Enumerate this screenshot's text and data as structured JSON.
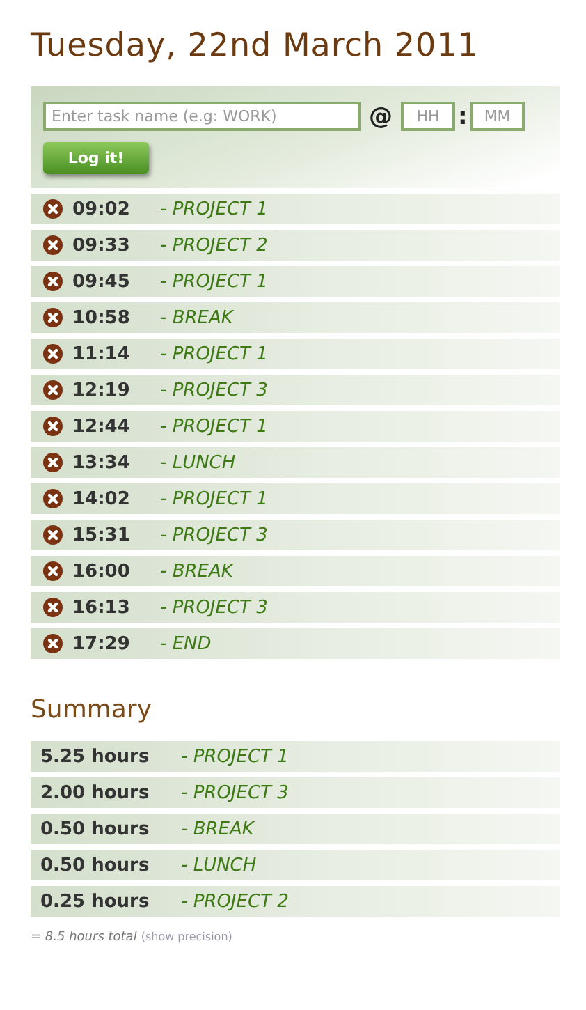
{
  "title": "Tuesday, 22nd March 2011",
  "form": {
    "task": {
      "placeholder": "Enter task name (e.g: WORK)"
    },
    "at": "@",
    "hours": {
      "placeholder": "HH"
    },
    "colon": ":",
    "minutes": {
      "placeholder": "MM"
    },
    "button": "Log it!"
  },
  "entries": [
    {
      "time": "09:02",
      "task": "- PROJECT 1"
    },
    {
      "time": "09:33",
      "task": "- PROJECT 2"
    },
    {
      "time": "09:45",
      "task": "- PROJECT 1"
    },
    {
      "time": "10:58",
      "task": "- BREAK"
    },
    {
      "time": "11:14",
      "task": "- PROJECT 1"
    },
    {
      "time": "12:19",
      "task": "- PROJECT 3"
    },
    {
      "time": "12:44",
      "task": "- PROJECT 1"
    },
    {
      "time": "13:34",
      "task": "- LUNCH"
    },
    {
      "time": "14:02",
      "task": "- PROJECT 1"
    },
    {
      "time": "15:31",
      "task": "- PROJECT 3"
    },
    {
      "time": "16:00",
      "task": "- BREAK"
    },
    {
      "time": "16:13",
      "task": "- PROJECT 3"
    },
    {
      "time": "17:29",
      "task": "- END"
    }
  ],
  "summary": {
    "heading": "Summary",
    "rows": [
      {
        "hours": "5.25 hours",
        "task": "- PROJECT 1"
      },
      {
        "hours": "2.00 hours",
        "task": "- PROJECT 3"
      },
      {
        "hours": "0.50 hours",
        "task": "- BREAK"
      },
      {
        "hours": "0.50 hours",
        "task": "- LUNCH"
      },
      {
        "hours": "0.25 hours",
        "task": "- PROJECT 2"
      }
    ],
    "total": "= 8.5 hours total",
    "link": "(show precision)"
  }
}
